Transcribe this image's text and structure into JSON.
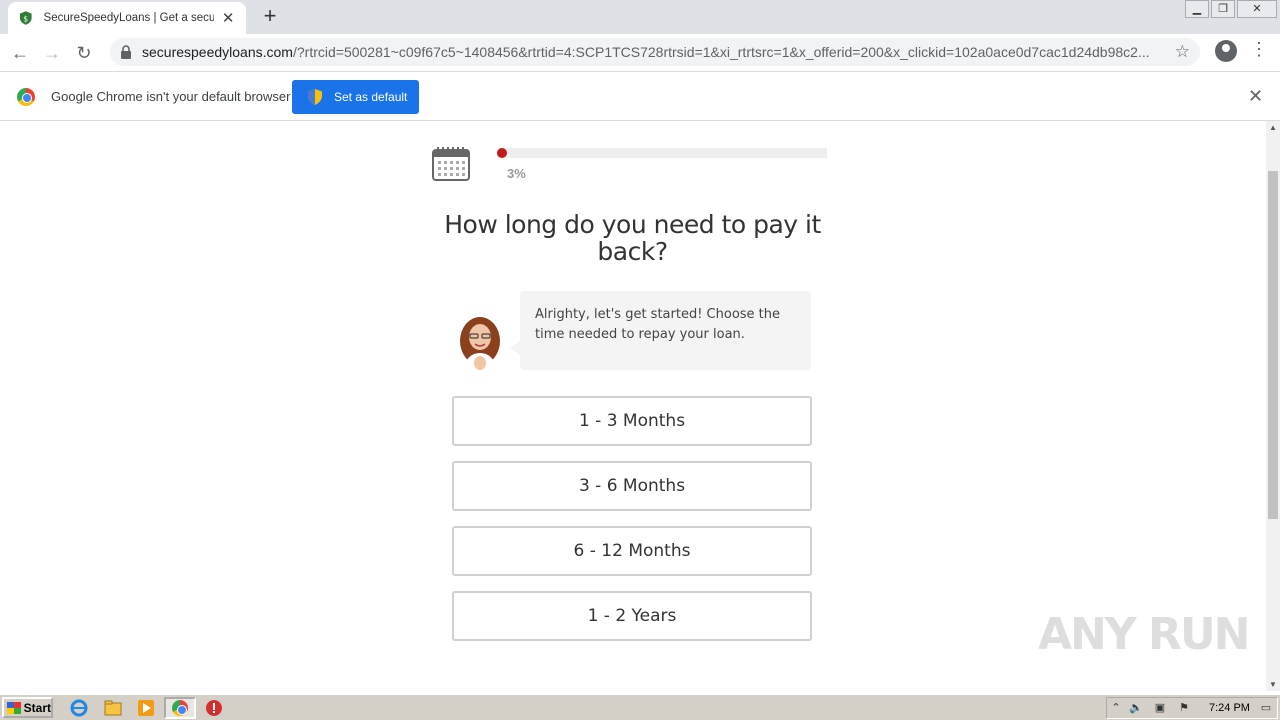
{
  "browser": {
    "tab_title": "SecureSpeedyLoans | Get a secure l",
    "url_host": "securespeedyloans.com",
    "url_path": "/?rtrcid=500281~c09f67c5~1408456&rtrtid=4:SCP1TCS728rtrsid=1&xi_rtrtsrc=1&x_offerid=200&x_clickid=102a0ace0d7cac1d24db98c2..."
  },
  "infobar": {
    "message": "Google Chrome isn't your default browser",
    "button_label": "Set as default"
  },
  "page": {
    "progress_percent": 3,
    "progress_label": "3%",
    "question": "How long do you need to pay it back?",
    "bubble_text": "Alrighty, let's get started! Choose the time needed to repay your loan.",
    "options": [
      "1 - 3 Months",
      "3 - 6 Months",
      "6 - 12 Months",
      "1 - 2 Years"
    ],
    "accent_color": "#c21a1a"
  },
  "watermark": "ANY RUN",
  "taskbar": {
    "start_label": "Start",
    "clock": "7:24 PM"
  }
}
